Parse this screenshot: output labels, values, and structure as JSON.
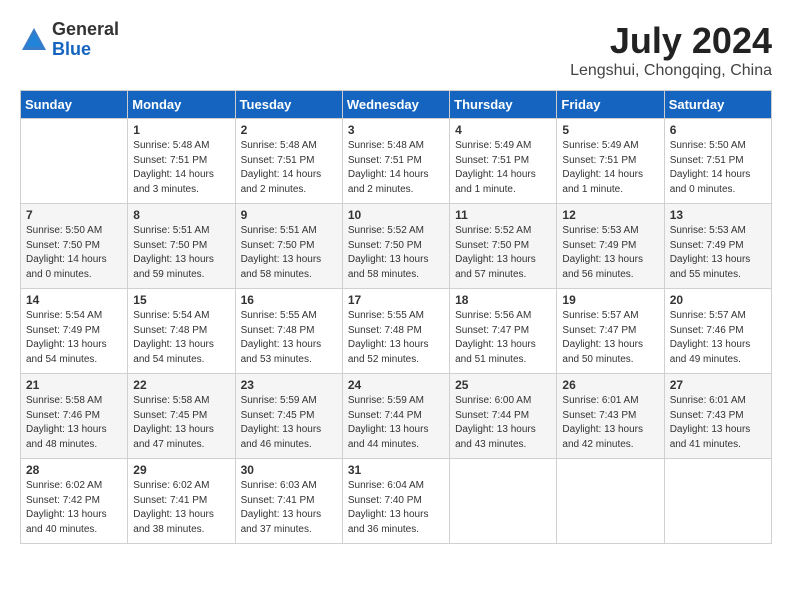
{
  "logo": {
    "general": "General",
    "blue": "Blue"
  },
  "header": {
    "month": "July 2024",
    "location": "Lengshui, Chongqing, China"
  },
  "days_of_week": [
    "Sunday",
    "Monday",
    "Tuesday",
    "Wednesday",
    "Thursday",
    "Friday",
    "Saturday"
  ],
  "weeks": [
    [
      {
        "day": "",
        "info": ""
      },
      {
        "day": "1",
        "info": "Sunrise: 5:48 AM\nSunset: 7:51 PM\nDaylight: 14 hours\nand 3 minutes."
      },
      {
        "day": "2",
        "info": "Sunrise: 5:48 AM\nSunset: 7:51 PM\nDaylight: 14 hours\nand 2 minutes."
      },
      {
        "day": "3",
        "info": "Sunrise: 5:48 AM\nSunset: 7:51 PM\nDaylight: 14 hours\nand 2 minutes."
      },
      {
        "day": "4",
        "info": "Sunrise: 5:49 AM\nSunset: 7:51 PM\nDaylight: 14 hours\nand 1 minute."
      },
      {
        "day": "5",
        "info": "Sunrise: 5:49 AM\nSunset: 7:51 PM\nDaylight: 14 hours\nand 1 minute."
      },
      {
        "day": "6",
        "info": "Sunrise: 5:50 AM\nSunset: 7:51 PM\nDaylight: 14 hours\nand 0 minutes."
      }
    ],
    [
      {
        "day": "7",
        "info": "Sunrise: 5:50 AM\nSunset: 7:50 PM\nDaylight: 14 hours\nand 0 minutes."
      },
      {
        "day": "8",
        "info": "Sunrise: 5:51 AM\nSunset: 7:50 PM\nDaylight: 13 hours\nand 59 minutes."
      },
      {
        "day": "9",
        "info": "Sunrise: 5:51 AM\nSunset: 7:50 PM\nDaylight: 13 hours\nand 58 minutes."
      },
      {
        "day": "10",
        "info": "Sunrise: 5:52 AM\nSunset: 7:50 PM\nDaylight: 13 hours\nand 58 minutes."
      },
      {
        "day": "11",
        "info": "Sunrise: 5:52 AM\nSunset: 7:50 PM\nDaylight: 13 hours\nand 57 minutes."
      },
      {
        "day": "12",
        "info": "Sunrise: 5:53 AM\nSunset: 7:49 PM\nDaylight: 13 hours\nand 56 minutes."
      },
      {
        "day": "13",
        "info": "Sunrise: 5:53 AM\nSunset: 7:49 PM\nDaylight: 13 hours\nand 55 minutes."
      }
    ],
    [
      {
        "day": "14",
        "info": "Sunrise: 5:54 AM\nSunset: 7:49 PM\nDaylight: 13 hours\nand 54 minutes."
      },
      {
        "day": "15",
        "info": "Sunrise: 5:54 AM\nSunset: 7:48 PM\nDaylight: 13 hours\nand 54 minutes."
      },
      {
        "day": "16",
        "info": "Sunrise: 5:55 AM\nSunset: 7:48 PM\nDaylight: 13 hours\nand 53 minutes."
      },
      {
        "day": "17",
        "info": "Sunrise: 5:55 AM\nSunset: 7:48 PM\nDaylight: 13 hours\nand 52 minutes."
      },
      {
        "day": "18",
        "info": "Sunrise: 5:56 AM\nSunset: 7:47 PM\nDaylight: 13 hours\nand 51 minutes."
      },
      {
        "day": "19",
        "info": "Sunrise: 5:57 AM\nSunset: 7:47 PM\nDaylight: 13 hours\nand 50 minutes."
      },
      {
        "day": "20",
        "info": "Sunrise: 5:57 AM\nSunset: 7:46 PM\nDaylight: 13 hours\nand 49 minutes."
      }
    ],
    [
      {
        "day": "21",
        "info": "Sunrise: 5:58 AM\nSunset: 7:46 PM\nDaylight: 13 hours\nand 48 minutes."
      },
      {
        "day": "22",
        "info": "Sunrise: 5:58 AM\nSunset: 7:45 PM\nDaylight: 13 hours\nand 47 minutes."
      },
      {
        "day": "23",
        "info": "Sunrise: 5:59 AM\nSunset: 7:45 PM\nDaylight: 13 hours\nand 46 minutes."
      },
      {
        "day": "24",
        "info": "Sunrise: 5:59 AM\nSunset: 7:44 PM\nDaylight: 13 hours\nand 44 minutes."
      },
      {
        "day": "25",
        "info": "Sunrise: 6:00 AM\nSunset: 7:44 PM\nDaylight: 13 hours\nand 43 minutes."
      },
      {
        "day": "26",
        "info": "Sunrise: 6:01 AM\nSunset: 7:43 PM\nDaylight: 13 hours\nand 42 minutes."
      },
      {
        "day": "27",
        "info": "Sunrise: 6:01 AM\nSunset: 7:43 PM\nDaylight: 13 hours\nand 41 minutes."
      }
    ],
    [
      {
        "day": "28",
        "info": "Sunrise: 6:02 AM\nSunset: 7:42 PM\nDaylight: 13 hours\nand 40 minutes."
      },
      {
        "day": "29",
        "info": "Sunrise: 6:02 AM\nSunset: 7:41 PM\nDaylight: 13 hours\nand 38 minutes."
      },
      {
        "day": "30",
        "info": "Sunrise: 6:03 AM\nSunset: 7:41 PM\nDaylight: 13 hours\nand 37 minutes."
      },
      {
        "day": "31",
        "info": "Sunrise: 6:04 AM\nSunset: 7:40 PM\nDaylight: 13 hours\nand 36 minutes."
      },
      {
        "day": "",
        "info": ""
      },
      {
        "day": "",
        "info": ""
      },
      {
        "day": "",
        "info": ""
      }
    ]
  ]
}
